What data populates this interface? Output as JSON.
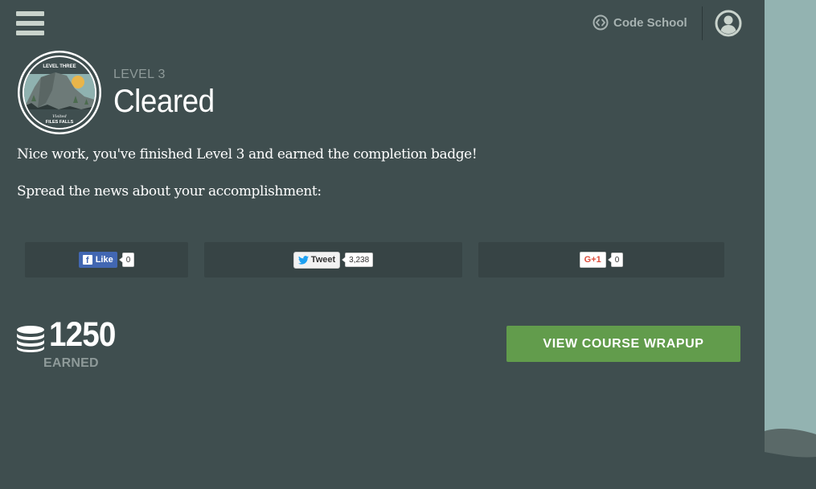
{
  "header": {
    "brand_label": "Code School",
    "icons": {
      "menu": "hamburger-menu-icon",
      "brand": "code-brackets-icon",
      "user": "user-avatar-icon"
    }
  },
  "badge": {
    "top_text": "LEVEL THREE",
    "script_text": "Visited",
    "bottom_text": "FILES FALLS"
  },
  "level": {
    "kicker": "LEVEL 3",
    "title": "Cleared"
  },
  "messages": {
    "completion": "Nice work, you've finished Level 3 and earned the completion badge!",
    "share_prompt": "Spread the news about your accomplishment:"
  },
  "share": {
    "facebook": {
      "label": "Like",
      "count": "0"
    },
    "twitter": {
      "label": "Tweet",
      "count": "3,238"
    },
    "googleplus": {
      "label": "G+1",
      "count": "0"
    }
  },
  "score": {
    "points": "1250",
    "label": "EARNED"
  },
  "cta": {
    "label": "VIEW COURSE WRAPUP"
  },
  "colors": {
    "panel_bg": "#3f4e4f",
    "share_box_bg": "#374445",
    "side_bg": "#93b3b1",
    "cta_bg": "#629c4c",
    "muted_text": "#8e9a99"
  }
}
